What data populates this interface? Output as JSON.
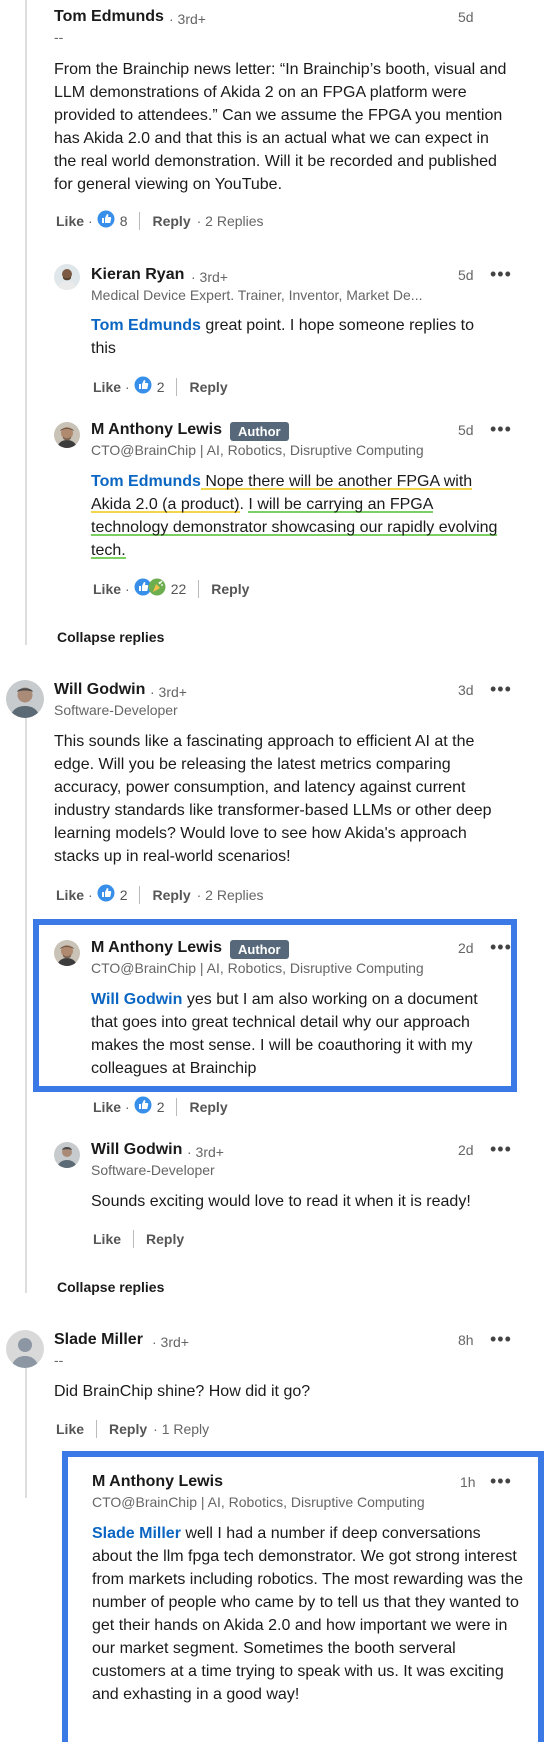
{
  "colors": {
    "accent": "#0a66c2",
    "highlight_box": "#3b79e6",
    "underline_yellow": "#f2d64b",
    "underline_green": "#7ccf62",
    "badge": "#56687a"
  },
  "labels": {
    "like": "Like",
    "reply": "Reply",
    "dot": "·",
    "author_badge": "Author",
    "collapse_replies": "Collapse replies"
  },
  "c1": {
    "name": "Tom Edmunds",
    "degree": "· 3rd+",
    "headline": "--",
    "time": "5d",
    "text": "From the Brainchip news letter: “In Brainchip’s booth, visual and LLM demonstrations of Akida 2 on an FPGA platform were provided to attendees.” Can we assume the FPGA you mention has Akida 2.0 and that this is an actual what we can expect in the real world demonstration. Will it be recorded and published for general viewing on YouTube.",
    "like_count": "8",
    "replies": "· 2 Replies"
  },
  "r1": {
    "name": "Kieran Ryan",
    "degree": "· 3rd+",
    "headline": "Medical Device Expert. Trainer, Inventor, Market De...",
    "time": "5d",
    "mention": "Tom Edmunds",
    "text": " great point. I hope someone replies to this",
    "like_count": "2"
  },
  "r2": {
    "name": "M Anthony Lewis",
    "headline": "CTO@BrainChip | AI, Robotics, Disruptive Computing",
    "time": "5d",
    "mention": "Tom Edmunds",
    "seg1": " Nope there will be another FPGA with Akida 2.0 (a product)",
    "seg2": ". ",
    "seg3": "I will be carrying an FPGA technology demonstrator showcasing our rapidly evolving tech.",
    "like_count": "22"
  },
  "c2": {
    "name": "Will Godwin",
    "degree": "· 3rd+",
    "headline": "Software-Developer",
    "time": "3d",
    "text": "This sounds like a fascinating approach to efficient AI at the edge. Will you be releasing the latest metrics comparing accuracy, power consumption, and latency against current industry standards like transformer-based LLMs or other deep learning models? Would love to see how Akida's approach stacks up in real-world scenarios!",
    "like_count": "2",
    "replies": "· 2 Replies"
  },
  "r3": {
    "name": "M Anthony Lewis",
    "headline": "CTO@BrainChip | AI, Robotics, Disruptive Computing",
    "time": "2d",
    "mention": "Will Godwin",
    "text": " yes but I am also working on a document that goes into great technical detail why our approach makes the most sense. I will be coauthoring it with my colleagues at Brainchip",
    "like_count": "2"
  },
  "r4": {
    "name": "Will Godwin",
    "degree": "· 3rd+",
    "headline": "Software-Developer",
    "time": "2d",
    "text": "Sounds exciting would love to read it when it is ready!"
  },
  "c3": {
    "name": "Slade Miller",
    "degree": "· 3rd+",
    "headline": "--",
    "time": "8h",
    "text": "Did BrainChip shine? How did it go?",
    "replies": "· 1 Reply"
  },
  "r5": {
    "name": "M Anthony Lewis",
    "headline": "CTO@BrainChip | AI, Robotics, Disruptive Computing",
    "time": "1h",
    "mention": "Slade Miller",
    "text": " well I had a number if deep conversations about the llm fpga tech demonstrator. We got strong interest from markets including robotics. The most rewarding was the number of people who came by to tell us that they wanted to get their hands on Akida 2.0 and how important we were in our market segment. Sometimes the booth serveral customers at a time trying to speak with us. It was exciting and exhasting in a good way!"
  }
}
